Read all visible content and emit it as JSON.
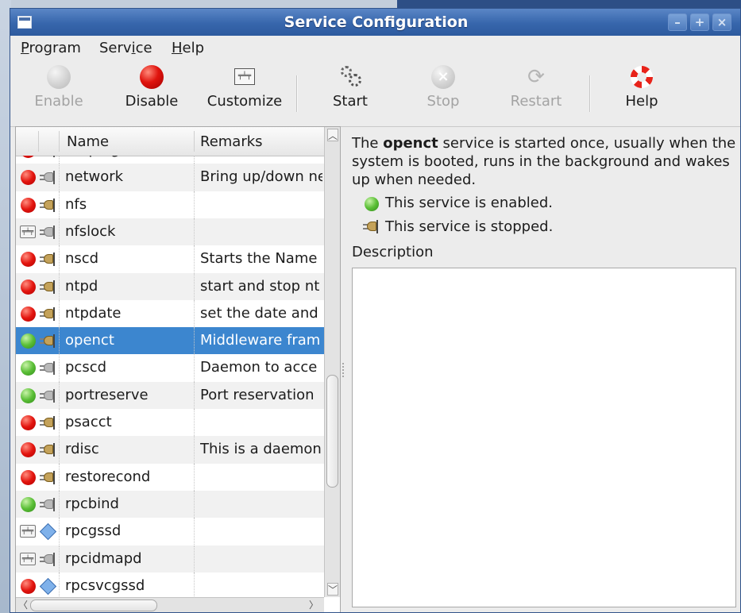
{
  "window": {
    "title": "Service Configuration"
  },
  "menubar": {
    "items": [
      {
        "label": "Program",
        "mnemonic_index": 0
      },
      {
        "label": "Service",
        "mnemonic_index": 4
      },
      {
        "label": "Help",
        "mnemonic_index": 0
      }
    ]
  },
  "toolbar": {
    "enable": {
      "label": "Enable",
      "enabled": false
    },
    "disable": {
      "label": "Disable",
      "enabled": true
    },
    "customize": {
      "label": "Customize",
      "enabled": true
    },
    "start": {
      "label": "Start",
      "enabled": true
    },
    "stop": {
      "label": "Stop",
      "enabled": false
    },
    "restart": {
      "label": "Restart",
      "enabled": false
    },
    "help": {
      "label": "Help",
      "enabled": true
    }
  },
  "service_list": {
    "columns": {
      "name": "Name",
      "remarks": "Remarks"
    },
    "rows": [
      {
        "name": "netplugd",
        "remarks": "",
        "enabled_icon": "red",
        "status_icon": "stopped-plug",
        "partial": "top"
      },
      {
        "name": "network",
        "remarks": "Bring up/down ne",
        "enabled_icon": "red",
        "status_icon": "stopped-plug"
      },
      {
        "name": "nfs",
        "remarks": "",
        "enabled_icon": "red",
        "status_icon": "running-plug"
      },
      {
        "name": "nfslock",
        "remarks": "",
        "enabled_icon": "config",
        "status_icon": "stopped-plug"
      },
      {
        "name": "nscd",
        "remarks": "Starts the Name",
        "enabled_icon": "red",
        "status_icon": "running-plug"
      },
      {
        "name": "ntpd",
        "remarks": "start and stop nt",
        "enabled_icon": "red",
        "status_icon": "running-plug"
      },
      {
        "name": "ntpdate",
        "remarks": "set the date and",
        "enabled_icon": "red",
        "status_icon": "running-plug"
      },
      {
        "name": "openct",
        "remarks": "Middleware fram",
        "enabled_icon": "green",
        "status_icon": "running-plug",
        "selected": true
      },
      {
        "name": "pcscd",
        "remarks": "Daemon to acce",
        "enabled_icon": "green",
        "status_icon": "stopped-plug"
      },
      {
        "name": "portreserve",
        "remarks": "Port reservation",
        "enabled_icon": "green",
        "status_icon": "stopped-plug"
      },
      {
        "name": "psacct",
        "remarks": "",
        "enabled_icon": "red",
        "status_icon": "running-plug"
      },
      {
        "name": "rdisc",
        "remarks": "This is a daemon",
        "enabled_icon": "red",
        "status_icon": "running-plug"
      },
      {
        "name": "restorecond",
        "remarks": "",
        "enabled_icon": "red",
        "status_icon": "running-plug"
      },
      {
        "name": "rpcbind",
        "remarks": "",
        "enabled_icon": "green",
        "status_icon": "stopped-plug"
      },
      {
        "name": "rpcgssd",
        "remarks": "",
        "enabled_icon": "config",
        "status_icon": "diamond"
      },
      {
        "name": "rpcidmapd",
        "remarks": "",
        "enabled_icon": "config",
        "status_icon": "stopped-plug"
      },
      {
        "name": "rpcsvcgssd",
        "remarks": "",
        "enabled_icon": "red",
        "status_icon": "diamond",
        "partial": "bottom"
      }
    ]
  },
  "details": {
    "intro_prefix": "The ",
    "service_name": "openct",
    "intro_suffix": " service is started once, usually when the system is booted, runs in the background and wakes up when needed.",
    "enabled_text": "This service is enabled.",
    "stopped_text": "This service is stopped.",
    "description_label": "Description",
    "description_text": ""
  },
  "colors": {
    "titlebar": "#3766ac",
    "selection": "#3c86cf",
    "enabled_green": "#5bbf37",
    "disabled_red": "#e3150f"
  }
}
